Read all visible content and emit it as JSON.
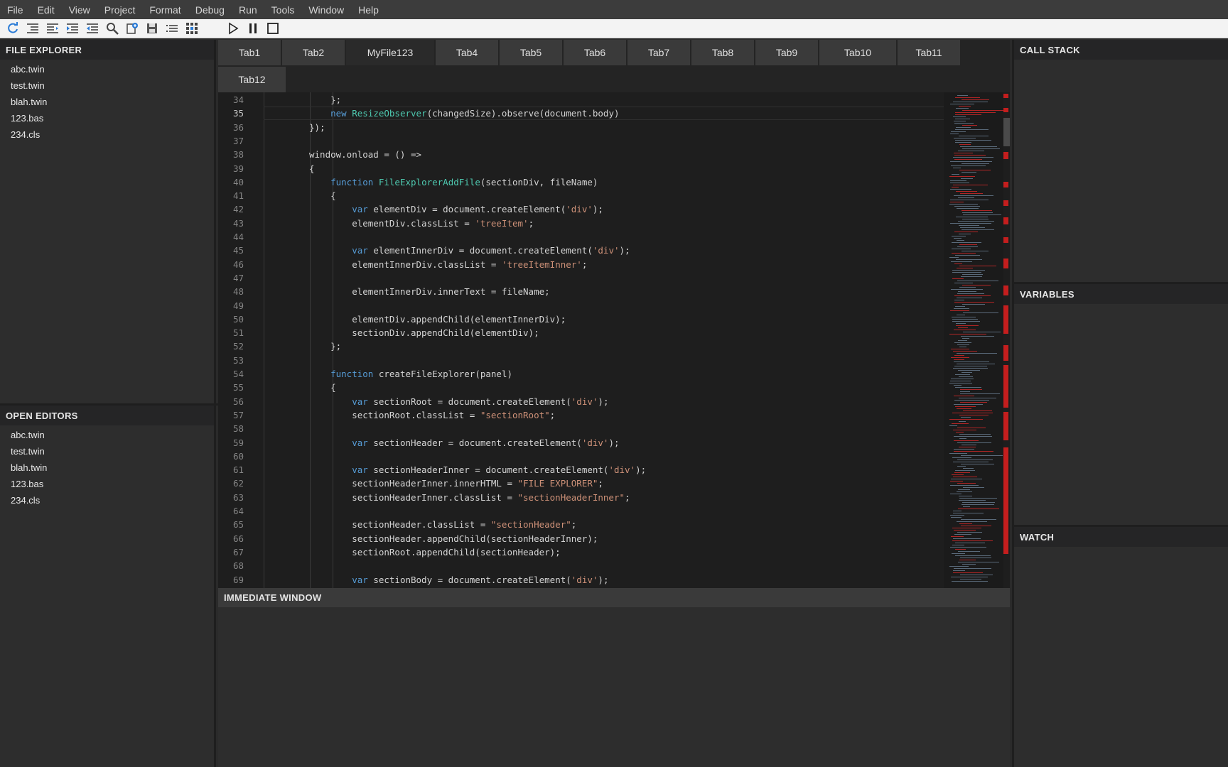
{
  "menu": [
    "File",
    "Edit",
    "View",
    "Project",
    "Format",
    "Debug",
    "Run",
    "Tools",
    "Window",
    "Help"
  ],
  "toolbar_icons": [
    "refresh-icon",
    "indent-icon",
    "outdent-icon",
    "indent-more-icon",
    "indent-less-icon",
    "search-icon",
    "new-file-icon",
    "save-icon",
    "list-icon",
    "grid-icon"
  ],
  "run_controls": [
    "play-icon",
    "pause-icon",
    "stop-icon"
  ],
  "file_explorer": {
    "title": "FILE EXPLORER",
    "files": [
      "abc.twin",
      "test.twin",
      "blah.twin",
      "123.bas",
      "234.cls"
    ]
  },
  "open_editors": {
    "title": "OPEN EDITORS",
    "files": [
      "abc.twin",
      "test.twin",
      "blah.twin",
      "123.bas",
      "234.cls"
    ]
  },
  "tabs": [
    "Tab1",
    "Tab2",
    "MyFile123",
    "Tab4",
    "Tab5",
    "Tab6",
    "Tab7",
    "Tab8",
    "Tab9",
    "Tab10",
    "Tab11",
    "Tab12"
  ],
  "active_tab": "MyFile123",
  "editor": {
    "current_line": 35,
    "lines": [
      {
        "n": 34,
        "parts": [
          {
            "t": "    };"
          }
        ]
      },
      {
        "n": 35,
        "parts": [
          {
            "t": "    "
          },
          {
            "t": "new",
            "c": "kw"
          },
          {
            "t": " "
          },
          {
            "t": "ResizeObserver",
            "c": "fn"
          },
          {
            "t": "(changedSize).observe(document.body)"
          }
        ]
      },
      {
        "n": 36,
        "parts": [
          {
            "t": "});"
          }
        ]
      },
      {
        "n": 37,
        "parts": [
          {
            "t": ""
          }
        ]
      },
      {
        "n": 38,
        "parts": [
          {
            "t": "window.onload = () =>"
          }
        ]
      },
      {
        "n": 39,
        "parts": [
          {
            "t": "{"
          }
        ]
      },
      {
        "n": 40,
        "parts": [
          {
            "t": "    "
          },
          {
            "t": "function",
            "c": "kw"
          },
          {
            "t": " "
          },
          {
            "t": "FileExplorerAddFile",
            "c": "fn"
          },
          {
            "t": "(sectionDiv, fileName)"
          }
        ]
      },
      {
        "n": 41,
        "parts": [
          {
            "t": "    {"
          }
        ]
      },
      {
        "n": 42,
        "parts": [
          {
            "t": "        "
          },
          {
            "t": "var",
            "c": "kw"
          },
          {
            "t": " elementDiv = document.createElement("
          },
          {
            "t": "'div'",
            "c": "str"
          },
          {
            "t": ");"
          }
        ]
      },
      {
        "n": 43,
        "parts": [
          {
            "t": "        elementDiv.classList = "
          },
          {
            "t": "'treeItem'",
            "c": "str"
          },
          {
            "t": ";"
          }
        ]
      },
      {
        "n": 44,
        "parts": [
          {
            "t": ""
          }
        ]
      },
      {
        "n": 45,
        "parts": [
          {
            "t": "        "
          },
          {
            "t": "var",
            "c": "kw"
          },
          {
            "t": " elementInnerDiv = document.createElement("
          },
          {
            "t": "'div'",
            "c": "str"
          },
          {
            "t": ");"
          }
        ]
      },
      {
        "n": 46,
        "parts": [
          {
            "t": "        elementInnerDiv.classList = "
          },
          {
            "t": "'treeItemInner'",
            "c": "str"
          },
          {
            "t": ";"
          }
        ]
      },
      {
        "n": 47,
        "parts": [
          {
            "t": ""
          }
        ]
      },
      {
        "n": 48,
        "parts": [
          {
            "t": "        elementInnerDiv.innerText = fileName;"
          }
        ]
      },
      {
        "n": 49,
        "parts": [
          {
            "t": ""
          }
        ]
      },
      {
        "n": 50,
        "parts": [
          {
            "t": "        elementDiv.appendChild(elementInnerDiv);"
          }
        ]
      },
      {
        "n": 51,
        "parts": [
          {
            "t": "        sectionDiv.appendChild(elementDiv);"
          }
        ]
      },
      {
        "n": 52,
        "parts": [
          {
            "t": "    };"
          }
        ]
      },
      {
        "n": 53,
        "parts": [
          {
            "t": ""
          }
        ]
      },
      {
        "n": 54,
        "parts": [
          {
            "t": "    "
          },
          {
            "t": "function",
            "c": "kw"
          },
          {
            "t": " createFileExplorer(panel)"
          }
        ]
      },
      {
        "n": 55,
        "parts": [
          {
            "t": "    {"
          }
        ]
      },
      {
        "n": 56,
        "parts": [
          {
            "t": "        "
          },
          {
            "t": "var",
            "c": "kw"
          },
          {
            "t": " sectionRoot = document.createElement("
          },
          {
            "t": "'div'",
            "c": "str"
          },
          {
            "t": ");"
          }
        ]
      },
      {
        "n": 57,
        "parts": [
          {
            "t": "        sectionRoot.classList = "
          },
          {
            "t": "\"sectionRoot\"",
            "c": "str"
          },
          {
            "t": ";"
          }
        ]
      },
      {
        "n": 58,
        "parts": [
          {
            "t": ""
          }
        ]
      },
      {
        "n": 59,
        "parts": [
          {
            "t": "        "
          },
          {
            "t": "var",
            "c": "kw"
          },
          {
            "t": " sectionHeader = document.createElement("
          },
          {
            "t": "'div'",
            "c": "str"
          },
          {
            "t": ");"
          }
        ]
      },
      {
        "n": 60,
        "parts": [
          {
            "t": ""
          }
        ]
      },
      {
        "n": 61,
        "parts": [
          {
            "t": "        "
          },
          {
            "t": "var",
            "c": "kw"
          },
          {
            "t": " sectionHeaderInner = document.createElement("
          },
          {
            "t": "'div'",
            "c": "str"
          },
          {
            "t": ");"
          }
        ]
      },
      {
        "n": 62,
        "parts": [
          {
            "t": "        sectionHeaderInner.innerHTML = "
          },
          {
            "t": "\"FILE EXPLORER\"",
            "c": "str"
          },
          {
            "t": ";"
          }
        ]
      },
      {
        "n": 63,
        "parts": [
          {
            "t": "        sectionHeaderInner.classList = "
          },
          {
            "t": "\"sectionHeaderInner\"",
            "c": "str"
          },
          {
            "t": ";"
          }
        ]
      },
      {
        "n": 64,
        "parts": [
          {
            "t": ""
          }
        ]
      },
      {
        "n": 65,
        "parts": [
          {
            "t": "        sectionHeader.classList = "
          },
          {
            "t": "\"sectionHeader\"",
            "c": "str"
          },
          {
            "t": ";"
          }
        ]
      },
      {
        "n": 66,
        "parts": [
          {
            "t": "        sectionHeader.appendChild(sectionHeaderInner);"
          }
        ]
      },
      {
        "n": 67,
        "parts": [
          {
            "t": "        sectionRoot.appendChild(sectionHeader);"
          }
        ]
      },
      {
        "n": 68,
        "parts": [
          {
            "t": ""
          }
        ]
      },
      {
        "n": 69,
        "parts": [
          {
            "t": "        "
          },
          {
            "t": "var",
            "c": "kw"
          },
          {
            "t": " sectionBody = document.createElement("
          },
          {
            "t": "'div'",
            "c": "str"
          },
          {
            "t": ");"
          }
        ]
      }
    ]
  },
  "immediate_window": {
    "title": "IMMEDIATE WINDOW"
  },
  "right_panels": {
    "call_stack": "CALL STACK",
    "variables": "VARIABLES",
    "watch": "WATCH"
  },
  "colors": {
    "keyword": "#569cd6",
    "type": "#4ec9b0",
    "string": "#ce9178",
    "error_marker": "#c41e1e"
  }
}
